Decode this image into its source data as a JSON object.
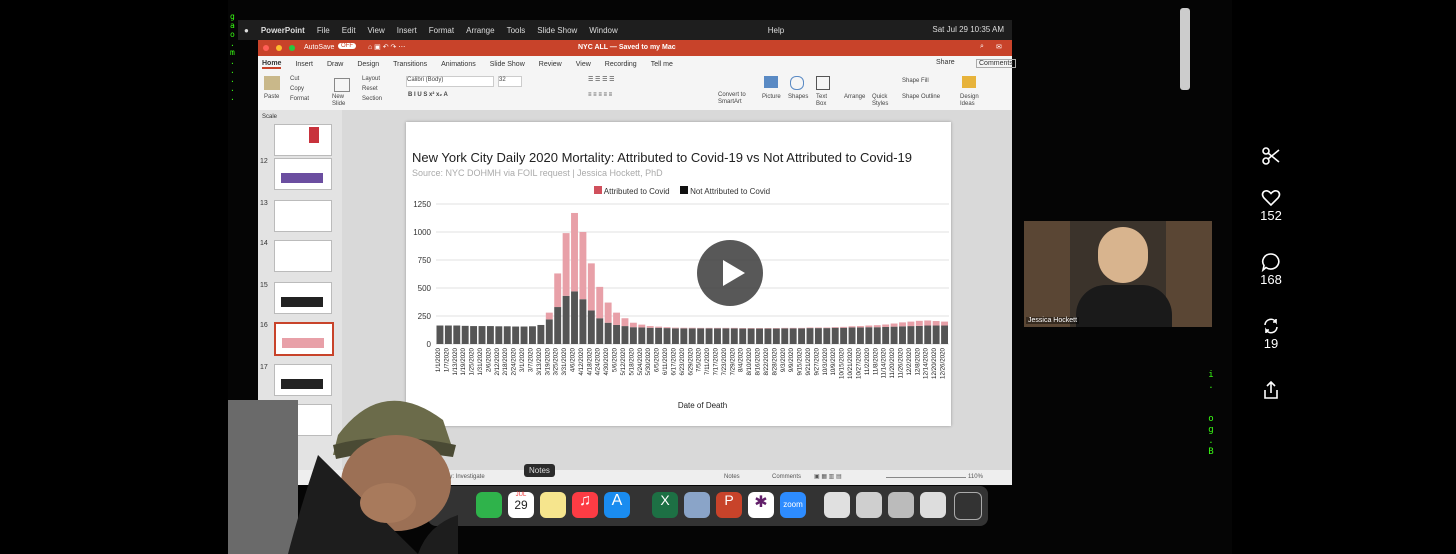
{
  "menubar": {
    "app": "PowerPoint",
    "items": [
      "File",
      "Edit",
      "View",
      "Insert",
      "Format",
      "Arrange",
      "Tools",
      "Slide Show",
      "Window",
      "Help"
    ],
    "clock": "Sat Jul 29  10:35 AM"
  },
  "titlebar": {
    "autosave": "AutoSave",
    "autosave_state": "OFF",
    "title": "NYC ALL — Saved to my Mac"
  },
  "ribbon_tabs": [
    "Home",
    "Insert",
    "Draw",
    "Design",
    "Transitions",
    "Animations",
    "Slide Show",
    "Review",
    "View",
    "Recording",
    "Tell me"
  ],
  "ribbon_right": {
    "share": "Share",
    "comments": "Comments"
  },
  "ribbon": {
    "paste": "Paste",
    "cut": "Cut",
    "copy": "Copy",
    "format": "Format",
    "new_slide": "New Slide",
    "layout": "Layout",
    "reset": "Reset",
    "section": "Section",
    "font": "Calibri (Body)",
    "size": "32",
    "picture": "Picture",
    "shapes": "Shapes",
    "text_box": "Text Box",
    "arrange": "Arrange",
    "quick_styles": "Quick Styles",
    "shape_fill": "Shape Fill",
    "shape_outline": "Shape Outline",
    "design_ideas": "Design Ideas",
    "convert_smartart": "Convert to SmartArt"
  },
  "thumbs": {
    "section": "Scale",
    "numbers": [
      "12",
      "13",
      "14",
      "15",
      "16",
      "17"
    ]
  },
  "statusbar": {
    "notes": "Notes",
    "comments": "Comments",
    "zoom": "110%",
    "tooltip": "Notes",
    "slide_note": "ly: Investigate"
  },
  "chart_data": {
    "type": "bar",
    "title": "New York City Daily 2020 Mortality: Attributed to Covid-19 vs Not Attributed to Covid-19",
    "subtitle": "Source: NYC DOHMH via FOIL request | Jessica Hockett, PhD",
    "xlabel": "Date of Death",
    "ylabel": "",
    "ylim": [
      0,
      1250
    ],
    "yticks": [
      0,
      250,
      500,
      750,
      1000,
      1250
    ],
    "legend_position": "top",
    "grid": true,
    "colors": {
      "covid": "#e8a0a8",
      "covid_legend": "#d0505c",
      "non_covid": "#555555"
    },
    "x_ticks": [
      "1/1/2020",
      "1/7/2020",
      "1/13/2020",
      "1/19/2020",
      "1/25/2020",
      "1/31/2020",
      "2/6/2020",
      "2/12/2020",
      "2/18/2020",
      "2/24/2020",
      "3/1/2020",
      "3/7/2020",
      "3/13/2020",
      "3/19/2020",
      "3/25/2020",
      "3/31/2020",
      "4/6/2020",
      "4/12/2020",
      "4/18/2020",
      "4/24/2020",
      "4/30/2020",
      "5/6/2020",
      "5/12/2020",
      "5/18/2020",
      "5/24/2020",
      "5/30/2020",
      "6/5/2020",
      "6/11/2020",
      "6/17/2020",
      "6/23/2020",
      "6/29/2020",
      "7/5/2020",
      "7/11/2020",
      "7/17/2020",
      "7/23/2020",
      "7/29/2020",
      "8/4/2020",
      "8/10/2020",
      "8/16/2020",
      "8/22/2020",
      "8/28/2020",
      "9/3/2020",
      "9/9/2020",
      "9/15/2020",
      "9/21/2020",
      "9/27/2020",
      "10/3/2020",
      "10/9/2020",
      "10/15/2020",
      "10/21/2020",
      "10/27/2020",
      "11/2/2020",
      "11/8/2020",
      "11/14/2020",
      "11/20/2020",
      "11/26/2020",
      "12/2/2020",
      "12/8/2020",
      "12/14/2020",
      "12/20/2020",
      "12/26/2020"
    ],
    "series": [
      {
        "name": "Attributed to Covid",
        "values": [
          0,
          0,
          0,
          0,
          0,
          0,
          0,
          0,
          0,
          0,
          0,
          0,
          0,
          60,
          300,
          560,
          700,
          600,
          420,
          280,
          180,
          110,
          70,
          40,
          25,
          15,
          10,
          8,
          6,
          5,
          5,
          4,
          4,
          4,
          4,
          4,
          4,
          4,
          4,
          4,
          4,
          4,
          4,
          4,
          5,
          5,
          5,
          6,
          8,
          10,
          12,
          15,
          18,
          22,
          28,
          35,
          40,
          45,
          45,
          40,
          35
        ]
      },
      {
        "name": "Not Attributed to Covid",
        "values": [
          165,
          165,
          165,
          162,
          160,
          160,
          160,
          158,
          158,
          156,
          156,
          158,
          170,
          220,
          330,
          430,
          470,
          400,
          300,
          230,
          190,
          170,
          160,
          150,
          148,
          145,
          145,
          142,
          140,
          140,
          140,
          140,
          140,
          140,
          140,
          140,
          138,
          138,
          138,
          138,
          138,
          140,
          140,
          140,
          142,
          142,
          142,
          145,
          145,
          148,
          148,
          150,
          150,
          152,
          155,
          158,
          160,
          162,
          165,
          165,
          165
        ]
      }
    ]
  },
  "webcam": {
    "name": "Jessica Hockett"
  },
  "sidebar": {
    "likes": "152",
    "comments": "168",
    "reposts": "19"
  },
  "dock": {
    "calendar_month": "JUL",
    "calendar_day": "29",
    "zoom": "zoom"
  }
}
